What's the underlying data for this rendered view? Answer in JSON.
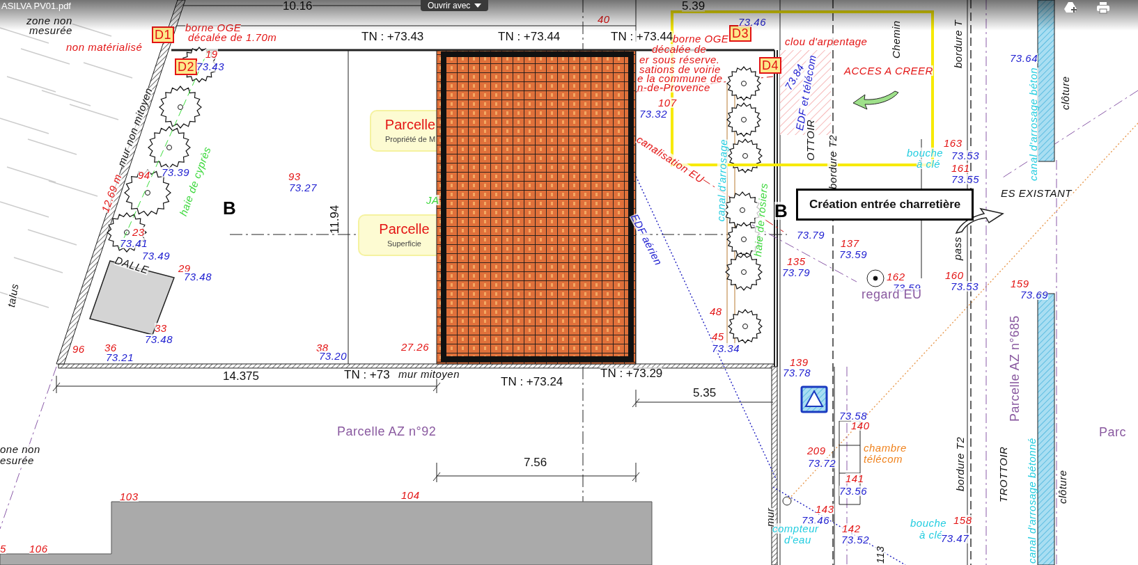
{
  "header": {
    "file_name": "ASILVA PV01.pdf",
    "open_with": "Ouvrir avec"
  },
  "callout": {
    "text": "Création entrée charretière"
  },
  "parcel_tags": [
    {
      "title": "Parcelle",
      "subtitle": "Propriété de M"
    },
    {
      "title": "Parcelle",
      "subtitle": "Superficie"
    }
  ],
  "labels": [
    {
      "text": "zone non",
      "kind": "label"
    },
    {
      "text": "mesurée",
      "kind": "label"
    },
    {
      "text": "10.16",
      "kind": "dimension"
    },
    {
      "text": "TN : +73.43",
      "kind": "level"
    },
    {
      "text": "TN : +73.44",
      "kind": "level"
    },
    {
      "text": "TN : +73.44",
      "kind": "level"
    },
    {
      "text": "5.39",
      "kind": "dimension"
    },
    {
      "text": "borne OGE",
      "kind": "remark"
    },
    {
      "text": "décalée de 1.70m",
      "kind": "remark"
    },
    {
      "text": "non matérialisé",
      "kind": "remark"
    },
    {
      "text": "D1",
      "kind": "marker"
    },
    {
      "text": "D2",
      "kind": "marker"
    },
    {
      "text": "19",
      "kind": "point"
    },
    {
      "text": "73.43",
      "kind": "altitude"
    },
    {
      "text": "mur non mitoyen",
      "kind": "label"
    },
    {
      "text": "haie de cyprès",
      "kind": "vegetation"
    },
    {
      "text": "12.69 m",
      "kind": "remark"
    },
    {
      "text": "94",
      "kind": "point"
    },
    {
      "text": "73.39",
      "kind": "altitude"
    },
    {
      "text": "93",
      "kind": "point"
    },
    {
      "text": "73.27",
      "kind": "altitude"
    },
    {
      "text": "11.94",
      "kind": "dimension"
    },
    {
      "text": "B",
      "kind": "section"
    },
    {
      "text": "23",
      "kind": "point"
    },
    {
      "text": "73.41",
      "kind": "altitude"
    },
    {
      "text": "DALLE",
      "kind": "label"
    },
    {
      "text": "73.49",
      "kind": "altitude"
    },
    {
      "text": "29",
      "kind": "point"
    },
    {
      "text": "73.48",
      "kind": "altitude"
    },
    {
      "text": "33",
      "kind": "point"
    },
    {
      "text": "73.48",
      "kind": "altitude"
    },
    {
      "text": "96",
      "kind": "point"
    },
    {
      "text": "36",
      "kind": "point"
    },
    {
      "text": "73.21",
      "kind": "altitude"
    },
    {
      "text": "38",
      "kind": "point"
    },
    {
      "text": "73.20",
      "kind": "altitude"
    },
    {
      "text": "27.26",
      "kind": "remark"
    },
    {
      "text": "14.375",
      "kind": "dimension"
    },
    {
      "text": "TN : +73",
      "kind": "level"
    },
    {
      "text": "mur mitoyen",
      "kind": "label"
    },
    {
      "text": "TN : +73.24",
      "kind": "level"
    },
    {
      "text": "TN : +73.29",
      "kind": "level"
    },
    {
      "text": "5.35",
      "kind": "dimension"
    },
    {
      "text": "Parcelle AZ n°92",
      "kind": "parcel"
    },
    {
      "text": "7.56",
      "kind": "dimension"
    },
    {
      "text": "talus",
      "kind": "label"
    },
    {
      "text": "one non",
      "kind": "label"
    },
    {
      "text": "esurée",
      "kind": "label"
    },
    {
      "text": "103",
      "kind": "point"
    },
    {
      "text": "104",
      "kind": "point"
    },
    {
      "text": "5",
      "kind": "point"
    },
    {
      "text": "106",
      "kind": "point"
    },
    {
      "text": "JA",
      "kind": "vegetation"
    },
    {
      "text": "40",
      "kind": "point"
    },
    {
      "text": "107",
      "kind": "point"
    },
    {
      "text": "73.32",
      "kind": "altitude"
    },
    {
      "text": "borne OGE",
      "kind": "remark"
    },
    {
      "text": "décalée de",
      "kind": "remark"
    },
    {
      "text": "er sous réserve.",
      "kind": "remark"
    },
    {
      "text": "sations de voirie",
      "kind": "remark"
    },
    {
      "text": "e la commune de",
      "kind": "remark"
    },
    {
      "text": "n-de-Provence",
      "kind": "remark"
    },
    {
      "text": "D3",
      "kind": "marker"
    },
    {
      "text": "D4",
      "kind": "marker"
    },
    {
      "text": "73.46",
      "kind": "altitude"
    },
    {
      "text": "clou d'arpentage",
      "kind": "remark"
    },
    {
      "text": "ACCES A CREER",
      "kind": "remark"
    },
    {
      "text": "73.84",
      "kind": "altitude"
    },
    {
      "text": "EDF et télécom",
      "kind": "electric"
    },
    {
      "text": "canal d'arrosage",
      "kind": "water"
    },
    {
      "text": "haie de rosiers",
      "kind": "vegetation"
    },
    {
      "text": "canalisation EU",
      "kind": "remark"
    },
    {
      "text": "EDF aérien",
      "kind": "electric"
    },
    {
      "text": "bordure T2",
      "kind": "label"
    },
    {
      "text": "OTTOIR",
      "kind": "label"
    },
    {
      "text": "Chemin",
      "kind": "label"
    },
    {
      "text": "bordure T",
      "kind": "label"
    },
    {
      "text": "clôture",
      "kind": "label"
    },
    {
      "text": "canal d'arrosage béton",
      "kind": "water"
    },
    {
      "text": "73.64",
      "kind": "altitude"
    },
    {
      "text": "163",
      "kind": "point"
    },
    {
      "text": "bouche",
      "kind": "water"
    },
    {
      "text": "à clé",
      "kind": "water"
    },
    {
      "text": "73.53",
      "kind": "altitude"
    },
    {
      "text": "161",
      "kind": "point"
    },
    {
      "text": "73.55",
      "kind": "altitude"
    },
    {
      "text": "ES EXISTANT",
      "kind": "label"
    },
    {
      "text": "pass",
      "kind": "label"
    },
    {
      "text": "B",
      "kind": "section"
    },
    {
      "text": "73.79",
      "kind": "altitude"
    },
    {
      "text": "137",
      "kind": "point"
    },
    {
      "text": "73.59",
      "kind": "altitude"
    },
    {
      "text": "135",
      "kind": "point"
    },
    {
      "text": "73.79",
      "kind": "altitude"
    },
    {
      "text": "162",
      "kind": "point"
    },
    {
      "text": "73.59",
      "kind": "altitude"
    },
    {
      "text": "regard EU",
      "kind": "parcel"
    },
    {
      "text": "160",
      "kind": "point"
    },
    {
      "text": "73.53",
      "kind": "altitude"
    },
    {
      "text": "159",
      "kind": "point"
    },
    {
      "text": "73.69",
      "kind": "altitude"
    },
    {
      "text": "48",
      "kind": "point"
    },
    {
      "text": "45",
      "kind": "point"
    },
    {
      "text": "73.34",
      "kind": "altitude"
    },
    {
      "text": "139",
      "kind": "point"
    },
    {
      "text": "73.78",
      "kind": "altitude"
    },
    {
      "text": "73.58",
      "kind": "altitude"
    },
    {
      "text": "140",
      "kind": "point"
    },
    {
      "text": "chambre",
      "kind": "telecom"
    },
    {
      "text": "télécom",
      "kind": "telecom"
    },
    {
      "text": "209",
      "kind": "point"
    },
    {
      "text": "73.72",
      "kind": "altitude"
    },
    {
      "text": "141",
      "kind": "point"
    },
    {
      "text": "73.56",
      "kind": "altitude"
    },
    {
      "text": "143",
      "kind": "point"
    },
    {
      "text": "73.46",
      "kind": "altitude"
    },
    {
      "text": "compteur",
      "kind": "water"
    },
    {
      "text": "d'eau",
      "kind": "water"
    },
    {
      "text": "142",
      "kind": "point"
    },
    {
      "text": "73.52",
      "kind": "altitude"
    },
    {
      "text": "bouche",
      "kind": "water"
    },
    {
      "text": "à clé",
      "kind": "water"
    },
    {
      "text": "158",
      "kind": "point"
    },
    {
      "text": "73.47",
      "kind": "altitude"
    },
    {
      "text": "bordure T2",
      "kind": "label"
    },
    {
      "text": "TROTTOIR",
      "kind": "label"
    },
    {
      "text": "Parcelle AZ n°685",
      "kind": "parcel"
    },
    {
      "text": "canal d'arrosage bétonné",
      "kind": "water"
    },
    {
      "text": "clôture",
      "kind": "label"
    },
    {
      "text": "Parc",
      "kind": "parcel"
    },
    {
      "text": "mur",
      "kind": "label"
    },
    {
      "text": "113",
      "kind": "label"
    }
  ]
}
